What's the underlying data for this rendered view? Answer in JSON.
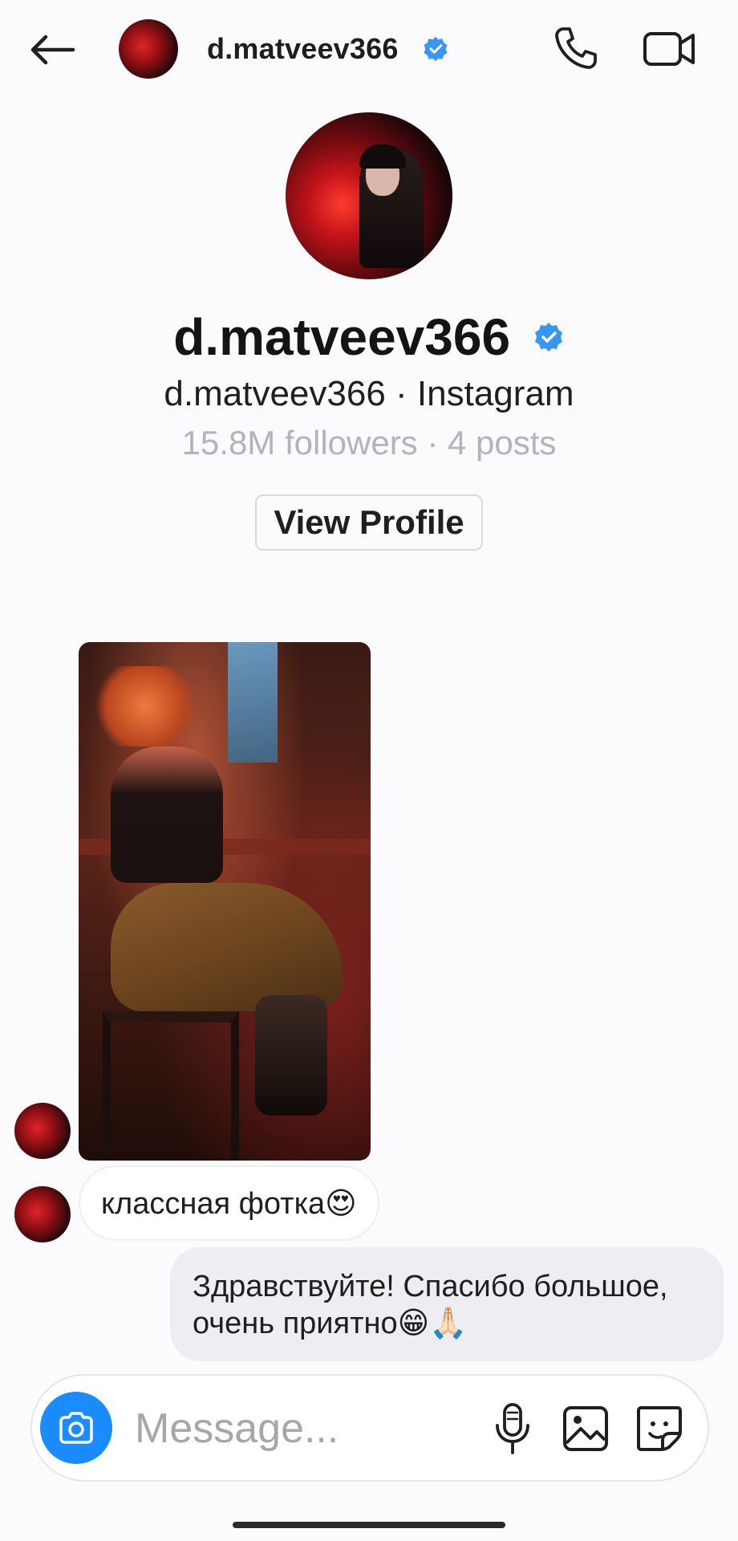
{
  "header": {
    "username": "d.matveev366",
    "verified": true
  },
  "profile": {
    "name": "d.matveev366",
    "subtitle": "d.matveev366 · Instagram",
    "stats": "15.8M followers · 4 posts",
    "view_profile_label": "View Profile"
  },
  "messages": {
    "incoming_text": "классная фотка😍",
    "outgoing_line1": "Здравствуйте! Спасибо большое,",
    "outgoing_line2": "очень приятно😁🙏🏻"
  },
  "composer": {
    "placeholder": "Message..."
  },
  "colors": {
    "accent": "#1a8cff",
    "verified_badge": "#3897f0",
    "outgoing_bubble": "#eeeef2"
  },
  "icons": [
    "back-arrow-icon",
    "phone-icon",
    "video-camera-icon",
    "verified-badge-icon",
    "camera-icon",
    "microphone-icon",
    "gallery-icon",
    "sticker-icon"
  ]
}
